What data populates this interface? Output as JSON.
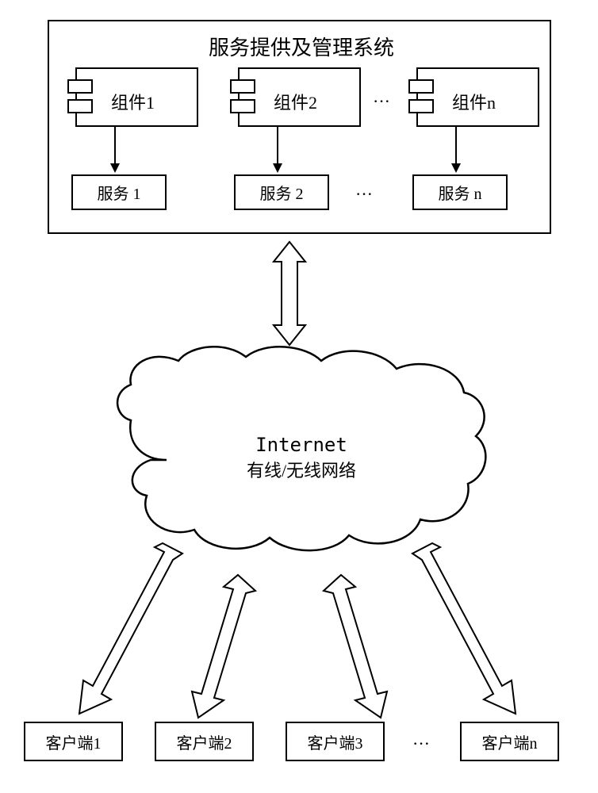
{
  "system_title": "服务提供及管理系统",
  "components": {
    "c1": "组件1",
    "c2": "组件2",
    "cn": "组件n",
    "dots": "···"
  },
  "services": {
    "s1": "服务 1",
    "s2": "服务 2",
    "sn": "服务 n",
    "dots": "···"
  },
  "cloud_line1": "Internet",
  "cloud_line2": "有线/无线网络",
  "clients": {
    "c1": "客户端1",
    "c2": "客户端2",
    "c3": "客户端3",
    "cn": "客户端n",
    "dots": "···"
  }
}
